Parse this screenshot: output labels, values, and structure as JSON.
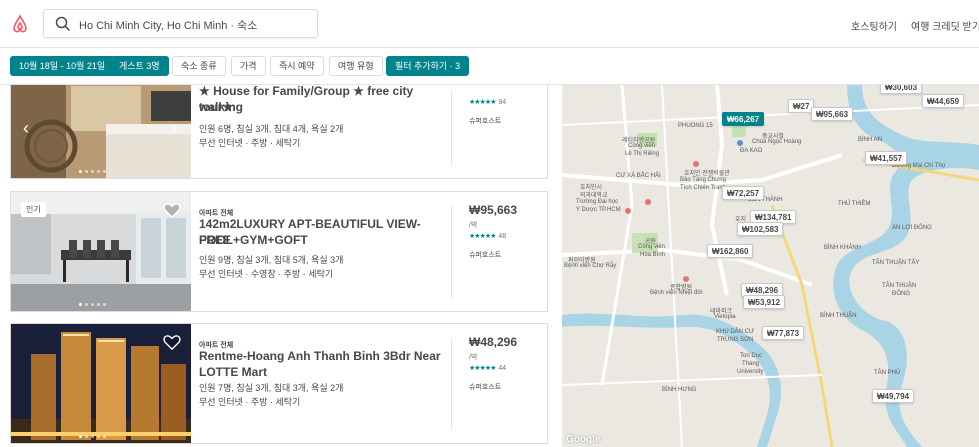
{
  "search": {
    "text": "Ho Chi Minh City, Ho Chi Minh · 숙소"
  },
  "nav": {
    "host": "호스팅하기",
    "credit": "여행 크레딧 받기"
  },
  "filters": [
    {
      "label": "10월 18일 - 10월 21일",
      "active": true
    },
    {
      "label": "게스트 3명",
      "active": true
    },
    {
      "label": "숙소 종류",
      "active": false
    },
    {
      "label": "가격",
      "active": false
    },
    {
      "label": "즉시 예약",
      "active": false
    },
    {
      "label": "여행 유형",
      "active": false
    },
    {
      "label": "필터 추가하기 · 3",
      "active": true
    }
  ],
  "listings": [
    {
      "title_top": "★ House for Family/Group ★ free city walking",
      "title_bottom": "tour★",
      "meta1": "인원 6명, 침실 3개, 침대 4개, 욕실 2개",
      "meta2": "무선 인터넷 · 주방 · 세탁기",
      "stars": "★★★★★",
      "reviews": "94",
      "host": "슈퍼호스트"
    },
    {
      "type": "아파트 전체",
      "title1": "142m2LUXURY APT-BEAUTIFUL VIEW-FREE",
      "title2": "POOL+GYM+GOFT",
      "meta1": "인원 9명, 침실 3개, 침대 5개, 욕실 3개",
      "meta2": "무선 인터넷 · 수영장 · 주방 · 세탁기",
      "badge": "인기",
      "price": "₩95,663",
      "per": "/박",
      "stars": "★★★★★",
      "reviews": "48",
      "host": "슈퍼호스트"
    },
    {
      "type": "아파트 전체",
      "title1": "Rentme-Hoang Anh Thanh Binh 3Bdr Near",
      "title2": "LOTTE Mart",
      "meta1": "인원 7명, 침실 3개, 침대 3개, 욕실 2개",
      "meta2": "무선 인터넷 · 주방 · 세탁기",
      "price": "₩48,296",
      "per": "/박",
      "stars": "★★★★★",
      "reviews": "44",
      "host": "슈퍼호스트"
    }
  ],
  "map": {
    "pins": [
      {
        "label": "₩30,603"
      },
      {
        "label": "₩27"
      },
      {
        "label": "₩44,659"
      },
      {
        "label": "₩95,663"
      },
      {
        "label": "₩66,267",
        "selected": true
      },
      {
        "label": "₩41,557"
      },
      {
        "label": "₩72,257"
      },
      {
        "label": "₩134,781"
      },
      {
        "label": "₩102,583"
      },
      {
        "label": "₩162,860"
      },
      {
        "label": "₩48,296"
      },
      {
        "label": "₩53,912"
      },
      {
        "label": "₩77,873"
      },
      {
        "label": "₩49,794"
      }
    ],
    "labels": {
      "l01": "PHUONG 15",
      "l02": "레티지엥공원",
      "l03": "Công viên",
      "l04": "Lê Thị Riêng",
      "l05": "CƯ XÁ BẮC HẢI",
      "l06": "호지민 전쟁박물관",
      "l07": "Bảo Tàng Chứng",
      "l08": "Tích Chiến Tranh",
      "l09": "호지민시",
      "l10": "의과대학교",
      "l11": "Trường Đại học",
      "l12": "Y Dược TP.HCM",
      "l13": "공원",
      "l14": "Công viên",
      "l15": "Hòa Bình",
      "l16": "퍼러이병원",
      "l17": "Bệnh viện Chợ Rẫy",
      "l18": "종합병원",
      "l19": "Bệnh viện Nhiệt đới",
      "l20": "테마파크",
      "l21": "Vietopia",
      "l22": "KHU DÂN CƯ",
      "l23": "TRUNG SƠN",
      "l24": "Ton Duc",
      "l25": "Thang",
      "l26": "University",
      "l27": "BÌNH HƯNG",
      "l28": "ĐA KAO",
      "l29": "BẾN THÀNH",
      "l30": "호지",
      "l31": "풍교사찰",
      "l32": "Chùa Ngọc Hoàng",
      "l33": "BÌNH AN",
      "l34": "THỦ THIÊM",
      "l35": "AN LỢI ĐÔNG",
      "l36": "TÂN THUẬN",
      "l37": "ĐÔNG",
      "l38": "TÂN PHÚ",
      "l39": "BÌNH THUẬN",
      "l40": "TÂN THUẬN TÂY",
      "l41": "BÌNH KHÁNH",
      "l42": "Đường Mai Chí Thọ",
      "l43": "Google"
    }
  }
}
